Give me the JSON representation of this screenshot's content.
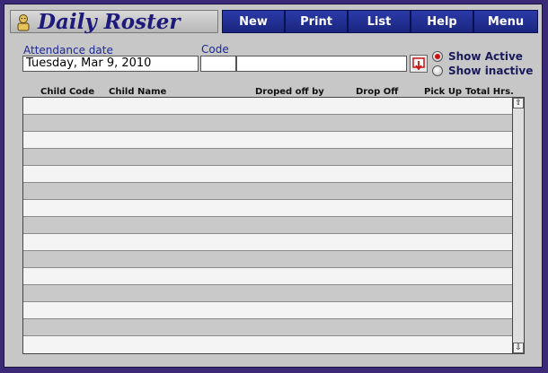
{
  "title": "Daily Roster",
  "nav": [
    {
      "label": "New"
    },
    {
      "label": "Print"
    },
    {
      "label": "List"
    },
    {
      "label": "Help"
    },
    {
      "label": "Menu"
    }
  ],
  "filters": {
    "attendance_date_label": "Attendance date",
    "attendance_date_value": "Tuesday, Mar 9, 2010",
    "code_label": "Code",
    "code_value": "",
    "code_name_value": ""
  },
  "radio": {
    "show_active": "Show Active",
    "show_inactive": "Show inactive",
    "selected": "show_active"
  },
  "table": {
    "columns": [
      "Child Code",
      "Child Name",
      "Droped off by",
      "Drop Off",
      "Pick Up",
      "Total Hrs."
    ],
    "rows": []
  },
  "colors": {
    "accent": "#1a267e",
    "title": "#1e1a7a",
    "radio_selected": "#cc1111"
  }
}
